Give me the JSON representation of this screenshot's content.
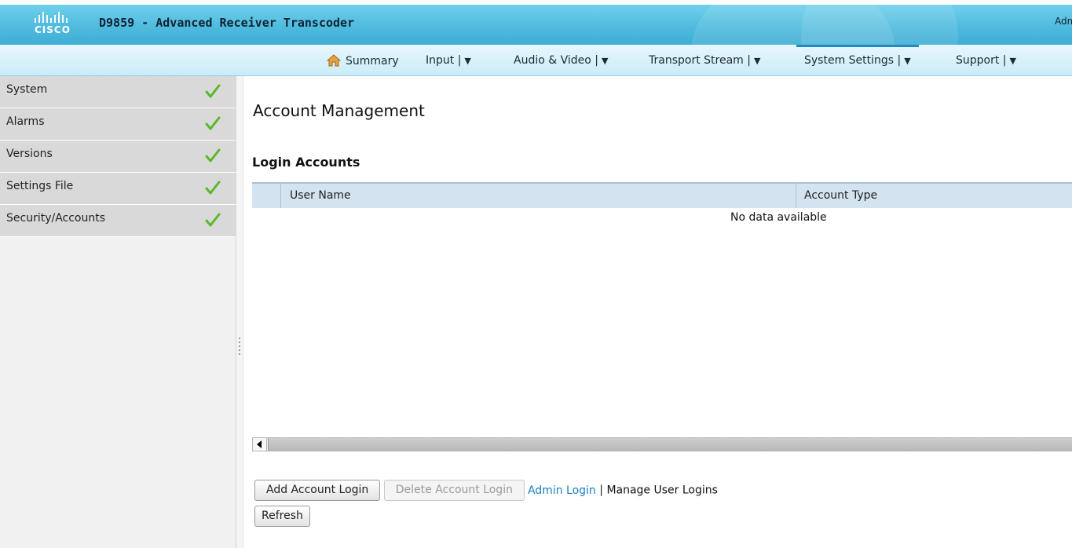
{
  "app": {
    "title": "D9859 - Advanced Receiver Transcoder",
    "brand": "CISCO",
    "user_label": "Adm"
  },
  "nav": {
    "items": [
      {
        "label": "Summary",
        "icon": "home-icon",
        "has_menu": false
      },
      {
        "label": "Input |",
        "has_menu": true
      },
      {
        "label": "Audio & Video |",
        "has_menu": true
      },
      {
        "label": "Transport Stream |",
        "has_menu": true
      },
      {
        "label": "System Settings |",
        "has_menu": true,
        "active": true
      },
      {
        "label": "Support |",
        "has_menu": true
      }
    ],
    "caret": "▼"
  },
  "sidebar": {
    "items": [
      {
        "label": "System",
        "status": "check-icon"
      },
      {
        "label": "Alarms",
        "status": "check-icon"
      },
      {
        "label": "Versions",
        "status": "check-icon"
      },
      {
        "label": "Settings File",
        "status": "check-icon"
      },
      {
        "label": "Security/Accounts",
        "status": "check-icon"
      }
    ]
  },
  "main": {
    "title": "Account Management",
    "section_title": "Login Accounts",
    "table": {
      "columns": [
        "User Name",
        "Account Type"
      ],
      "empty_text": "No data available"
    },
    "buttons": {
      "add": "Add Account Login",
      "delete": "Delete Account Login",
      "refresh": "Refresh"
    },
    "links": {
      "admin_login": "Admin Login",
      "separator": "|",
      "manage_user_logins": "Manage User Logins"
    }
  },
  "colors": {
    "header_accent": "#4db9dd",
    "nav_active": "#1e8bc3",
    "check_green": "#5cb82a",
    "link": "#1a7fc2"
  }
}
